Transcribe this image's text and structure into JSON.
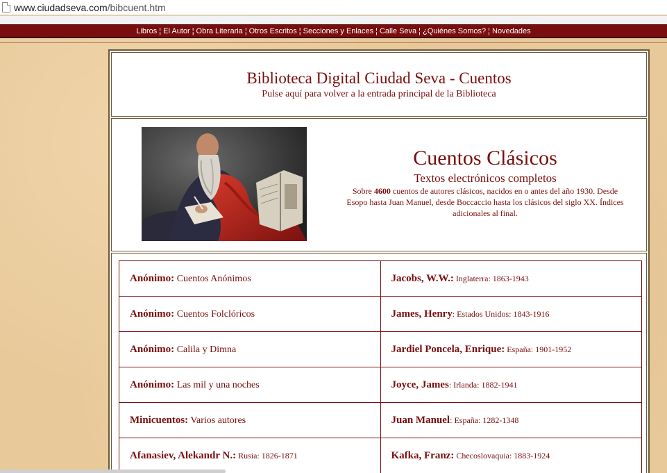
{
  "browser": {
    "url_host": "www.ciudadseva.com",
    "url_path": "/bibcuent.htm"
  },
  "nav": {
    "items": [
      "Libros",
      "El Autor",
      "Obra Literaria",
      "Otros Escritos",
      "Secciones y Enlaces",
      "Calle Seva",
      "¿Quiénes Somos?",
      "Novedades"
    ],
    "separator": "¦"
  },
  "header": {
    "title": "Biblioteca Digital Ciudad Seva - Cuentos",
    "subtitle": "Pulse aquí para volver a la entrada principal de la Biblioteca"
  },
  "hero": {
    "title": "Cuentos Clásicos",
    "subtitle": "Textos electrónicos completos",
    "desc_prefix": "Sobre ",
    "desc_count": "4600",
    "desc_rest": " cuentos de autores clásicos, nacidos en o antes del año 1930. Desde Esopo hasta Juan Manuel, desde Boccaccio hasta los clásicos del siglo XX. Índices adicionales al final."
  },
  "authors": {
    "left": [
      {
        "name": "Anónimo:",
        "detail": " Cuentos Anónimos",
        "type": "desc"
      },
      {
        "name": "Anónimo:",
        "detail": " Cuentos Folclóricos",
        "type": "desc"
      },
      {
        "name": "Anónimo:",
        "detail": " Calila y Dimna",
        "type": "desc"
      },
      {
        "name": "Anónimo:",
        "detail": " Las mil y una noches",
        "type": "desc"
      },
      {
        "name": "Minicuentos:",
        "detail": " Varios autores",
        "type": "desc"
      },
      {
        "name": "Afanasiev, Alekandr N.:",
        "detail": " Rusia: 1826-1871",
        "type": "meta"
      }
    ],
    "right": [
      {
        "name": "Jacobs, W.W.:",
        "detail": " Inglaterra: 1863-1943",
        "type": "meta"
      },
      {
        "name": "James, Henry",
        "detail": ": Estados Unidos: 1843-1916",
        "type": "meta"
      },
      {
        "name": "Jardiel Poncela, Enrique:",
        "detail": " España: 1901-1952",
        "type": "meta"
      },
      {
        "name": "Joyce, James",
        "detail": ": Irlanda: 1882-1941",
        "type": "meta"
      },
      {
        "name": "Juan Manuel",
        "detail": ": España: 1282-1348",
        "type": "meta"
      },
      {
        "name": "Kafka, Franz:",
        "detail": " Checoslovaquia: 1883-1924",
        "type": "meta"
      }
    ]
  },
  "colors": {
    "accent": "#7a0d0d",
    "nav_bg": "#7a0d0d",
    "page_bg": "#e8c99a"
  },
  "icons": {
    "page": "page-icon",
    "painting": "saint-jerome-painting"
  }
}
